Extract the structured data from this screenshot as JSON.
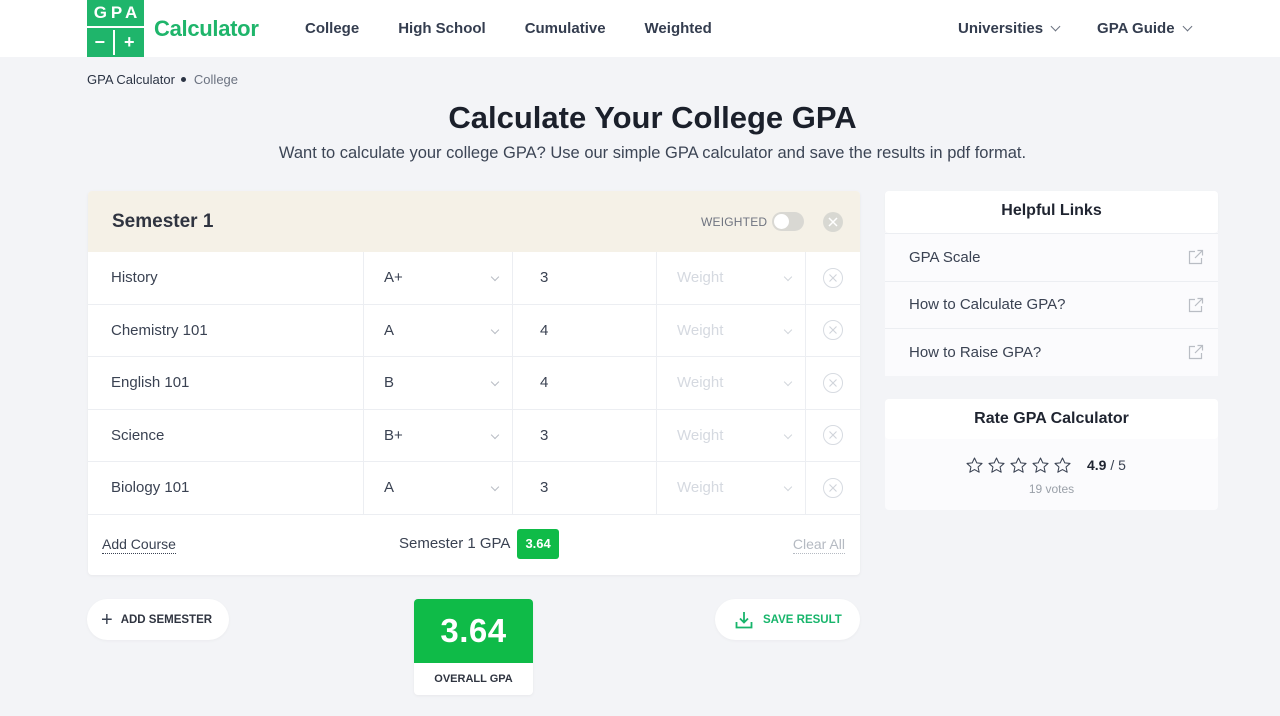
{
  "header": {
    "logo": {
      "top": "GPA",
      "minus": "−",
      "plus": "+",
      "text": "Calculator"
    },
    "nav_left": [
      "College",
      "High School",
      "Cumulative",
      "Weighted"
    ],
    "nav_right": [
      "Universities",
      "GPA Guide"
    ]
  },
  "breadcrumb": [
    "GPA Calculator",
    "College"
  ],
  "page": {
    "title": "Calculate Your College GPA",
    "subtitle": "Want to calculate your college GPA? Use our simple GPA calculator and save the results in pdf format."
  },
  "semester": {
    "title": "Semester 1",
    "weighted_label": "WEIGHTED",
    "weighted_on": false,
    "weight_placeholder": "Weight",
    "courses": [
      {
        "name": "History",
        "grade": "A+",
        "credits": "3"
      },
      {
        "name": "Chemistry 101",
        "grade": "A",
        "credits": "4"
      },
      {
        "name": "English 101",
        "grade": "B",
        "credits": "4"
      },
      {
        "name": "Science",
        "grade": "B+",
        "credits": "3"
      },
      {
        "name": "Biology 101",
        "grade": "A",
        "credits": "3"
      }
    ],
    "add_course": "Add Course",
    "gpa_label": "Semester 1 GPA",
    "gpa_value": "3.64",
    "clear_all": "Clear All"
  },
  "actions": {
    "add_semester": "ADD SEMESTER",
    "save_result": "SAVE RESULT"
  },
  "overall": {
    "value": "3.64",
    "label": "OVERALL GPA"
  },
  "helpful_links": {
    "title": "Helpful Links",
    "items": [
      "GPA Scale",
      "How to Calculate GPA?",
      "How to Raise GPA?"
    ]
  },
  "rating": {
    "title": "Rate GPA Calculator",
    "score": "4.9",
    "out_of": "/ 5",
    "votes": "19 votes",
    "stars_total": 5
  },
  "colors": {
    "brand_green": "#1fb56b",
    "gpa_green": "#0fbb48",
    "semester_header_bg": "#f5f1e7"
  }
}
